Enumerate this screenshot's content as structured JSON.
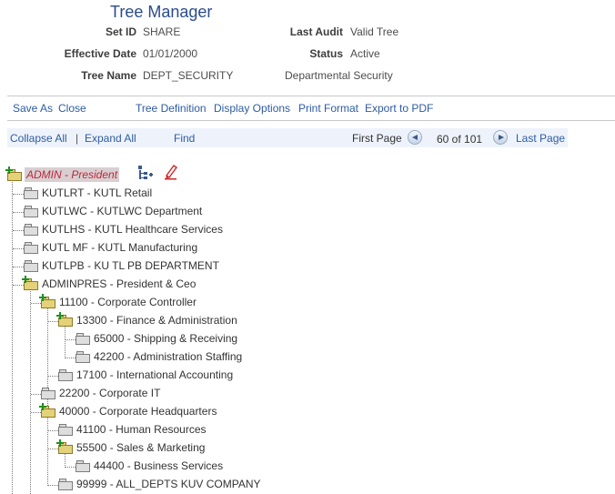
{
  "header": {
    "title": "Tree Manager",
    "set_id_label": "Set ID",
    "set_id_value": "SHARE",
    "last_audit_label": "Last Audit",
    "last_audit_value": "Valid Tree",
    "effective_date_label": "Effective Date",
    "effective_date_value": "01/01/2000",
    "status_label": "Status",
    "status_value": "Active",
    "tree_name_label": "Tree Name",
    "tree_name_value": "DEPT_SECURITY",
    "tree_description": "Departmental Security"
  },
  "actions": {
    "save_as": "Save As",
    "close": "Close",
    "tree_definition": "Tree Definition",
    "display_options": "Display Options",
    "print_format": "Print Format",
    "export_pdf": "Export to PDF"
  },
  "navbar": {
    "collapse_all": "Collapse All",
    "separator": "|",
    "expand_all": "Expand All",
    "find": "Find",
    "first_page": "First Page",
    "page_count": "60 of 101",
    "last_page": "Last Page"
  },
  "tree": {
    "root": "ADMIN - President",
    "nodes": [
      {
        "label": "KUTLRT - KUTL Retail",
        "open": false
      },
      {
        "label": "KUTLWC - KUTLWC Department",
        "open": false
      },
      {
        "label": "KUTLHS - KUTL Healthcare Services",
        "open": false
      },
      {
        "label": "KUTL MF - KUTL Manufacturing",
        "open": false
      },
      {
        "label": "KUTLPB - KU TL PB DEPARTMENT",
        "open": false
      },
      {
        "label": "ADMINPRES - President & Ceo",
        "open": true
      },
      {
        "label": "11100 - Corporate Controller",
        "open": true
      },
      {
        "label": "13300 - Finance & Administration",
        "open": true
      },
      {
        "label": "65000 - Shipping & Receiving",
        "open": false
      },
      {
        "label": "42200 - Administration Staffing",
        "open": false
      },
      {
        "label": "17100 - International Accounting",
        "open": false
      },
      {
        "label": "22200 - Corporate IT",
        "open": false
      },
      {
        "label": "40000 - Corporate Headquarters",
        "open": true
      },
      {
        "label": "41100 - Human Resources",
        "open": false
      },
      {
        "label": "55500 - Sales & Marketing",
        "open": true
      },
      {
        "label": "44400 - Business Services",
        "open": false
      },
      {
        "label": "99999 - ALL_DEPTS KUV COMPANY",
        "open": false
      }
    ]
  },
  "icons": {
    "insert_node": "insert-child-icon",
    "edit_node": "edit-pencil-icon",
    "folder_closed": "folder-closed-icon",
    "folder_open": "folder-open-icon"
  },
  "colors": {
    "title": "#2b4c8c",
    "link": "#2d5ca3",
    "root_highlight": "#d8cfd2",
    "root_text": "#c0263a",
    "navbar_bg": "#eef3fb"
  }
}
